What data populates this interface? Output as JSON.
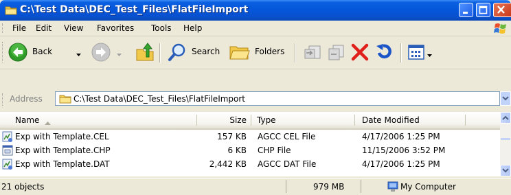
{
  "window": {
    "title": "C:\\Test Data\\DEC_Test_Files\\FlatFileImport"
  },
  "menu": [
    "File",
    "Edit",
    "View",
    "Favorites",
    "Tools",
    "Help"
  ],
  "toolbar": {
    "back_label": "Back",
    "search_label": "Search",
    "folders_label": "Folders"
  },
  "address": {
    "label": "Address",
    "value": "C:\\Test Data\\DEC_Test_Files\\FlatFileImport"
  },
  "columns": {
    "name": "Name",
    "size": "Size",
    "type": "Type",
    "date": "Date Modified"
  },
  "files": [
    {
      "name": "Exp with Template.CEL",
      "size": "157 KB",
      "type": "AGCC CEL File",
      "date": "4/17/2006 1:25 PM",
      "icon": "agcc-file-icon"
    },
    {
      "name": "Exp with Template.CHP",
      "size": "6 KB",
      "type": "CHP File",
      "date": "11/15/2006 3:52 PM",
      "icon": "chp-file-icon"
    },
    {
      "name": "Exp with Template.DAT",
      "size": "2,442 KB",
      "type": "AGCC DAT File",
      "date": "4/17/2006 1:25 PM",
      "icon": "agcc-file-icon"
    }
  ],
  "status": {
    "count": "21 objects",
    "size": "979 MB",
    "location": "My Computer"
  },
  "colors": {
    "titlebar": "#0555d9",
    "close_button": "#c8391a",
    "toolbar_bg": "#ece9d8",
    "delete_x": "#e0201a"
  }
}
